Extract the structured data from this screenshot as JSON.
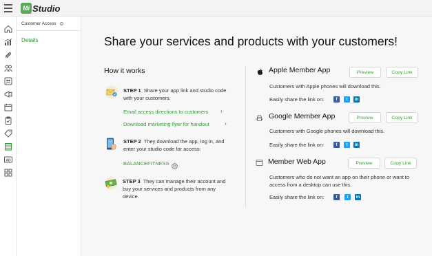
{
  "app": {
    "logo_letters": "Mi",
    "logo_text": "Studio"
  },
  "subnav": {
    "heading": "Customer Access",
    "info_icon": "info-icon",
    "item": "Details"
  },
  "main": {
    "title": "Share your services and products with your customers!",
    "how_it_works": "How it works",
    "steps": [
      {
        "label": "STEP 1",
        "text": "Share your app link and studio code with your customers.",
        "icon": "envelope-icon"
      },
      {
        "label": "STEP 2",
        "text": "They download the app, log in, and enter your studio code for access:",
        "icon": "phone-icon"
      },
      {
        "label": "STEP 3",
        "text": "They can manage their account and buy your services and products from any device.",
        "icon": "money-icon"
      }
    ],
    "links": {
      "email": "Email access directions to customers",
      "flyer": "Download marketing flyer for handout",
      "studio_code": "BALANCEFITNESS"
    }
  },
  "apps": [
    {
      "title": "Apple Member App",
      "icon": "apple-icon",
      "preview": "Preview",
      "copy": "Copy Link",
      "desc": "Customers with Apple phones will download this.",
      "share": "Easily share the link on:"
    },
    {
      "title": "Google Member App",
      "icon": "android-icon",
      "preview": "Preview",
      "copy": "Copy Link",
      "desc": "Customers with Google phones will download this.",
      "share": "Easily share the link on:"
    },
    {
      "title": "Member Web App",
      "icon": "browser-icon",
      "preview": "Preview",
      "copy": "Copy Link",
      "desc": "Customers who do not want an app on their phone or want to access from a desktop can use this.",
      "share": "Easily share the link on:"
    }
  ],
  "social": {
    "facebook": "f",
    "twitter": "t",
    "linkedin": "in"
  },
  "rail_icons": [
    "home-icon",
    "chart-icon",
    "tag-icon",
    "users-icon",
    "group-icon",
    "megaphone-icon",
    "calendar-icon",
    "clipboard-icon",
    "price-tag-icon",
    "store-icon",
    "ad-icon",
    "apps-icon"
  ],
  "colors": {
    "accent": "#3a9a3a",
    "facebook": "#3b5998",
    "twitter": "#1da1f2",
    "linkedin": "#0e76a8"
  }
}
